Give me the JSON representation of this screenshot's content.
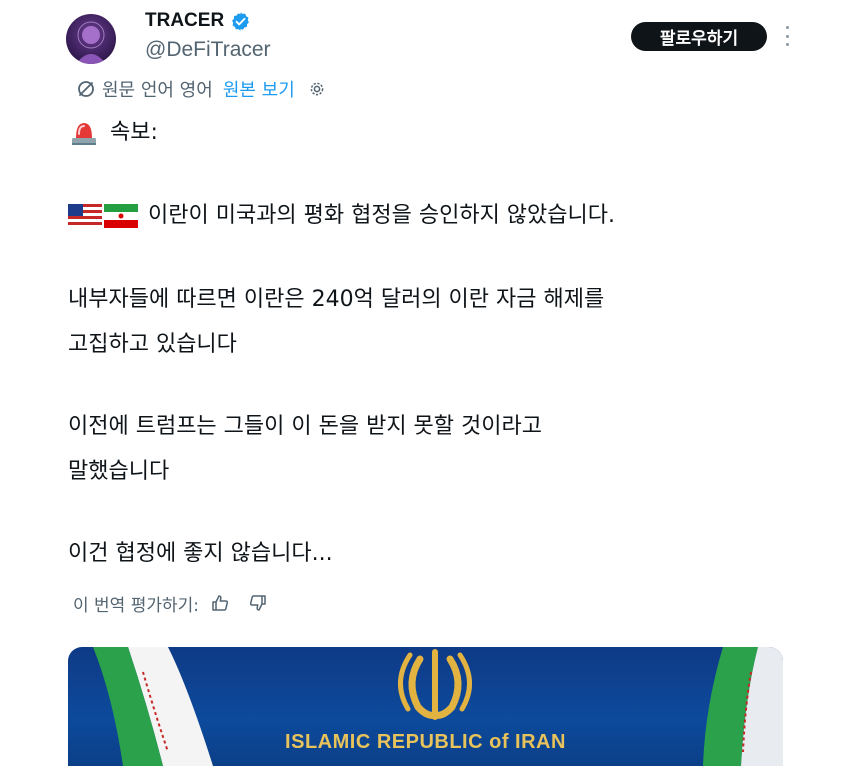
{
  "author": {
    "display_name": "TRACER",
    "handle": "@DeFiTracer",
    "verified_icon": "verified-badge-icon",
    "avatar_icon": "avatar"
  },
  "actions": {
    "follow_label": "팔로우하기",
    "more_icon": "more-dots-icon"
  },
  "translation": {
    "translate_icon": "translate-icon",
    "source_language_text": "원문 언어 영어",
    "show_original_label": "원본 보기",
    "settings_icon": "gear-icon"
  },
  "tweet": {
    "line1": "속보:",
    "line1_icon": "siren-emoji-icon",
    "line2": "이란이 미국과의 평화 협정을 승인하지 않았습니다.",
    "line2_icons": [
      "us-flag-icon",
      "iran-flag-icon"
    ],
    "line3": "내부자들에 따르면 이란은 240억 달러의 이란 자금 해제를",
    "line4": "고집하고 있습니다",
    "line5": "이전에 트럼프는 그들이 이 돈을 받지 못할 것이라고",
    "line6": "말했습니다",
    "line7": "이건 협정에 좋지 않습니다..."
  },
  "rating": {
    "label": "이 번역 평가하기:",
    "thumbs_up_icon": "thumbs-up-icon",
    "thumbs_down_icon": "thumbs-down-icon"
  },
  "media": {
    "caption": "ISLAMIC REPUBLIC of IRAN"
  },
  "colors": {
    "text": "#0f1419",
    "secondary": "#536471",
    "link": "#1d9bf0",
    "verified": "#1d9bf0",
    "follow_bg": "#0f1419"
  }
}
